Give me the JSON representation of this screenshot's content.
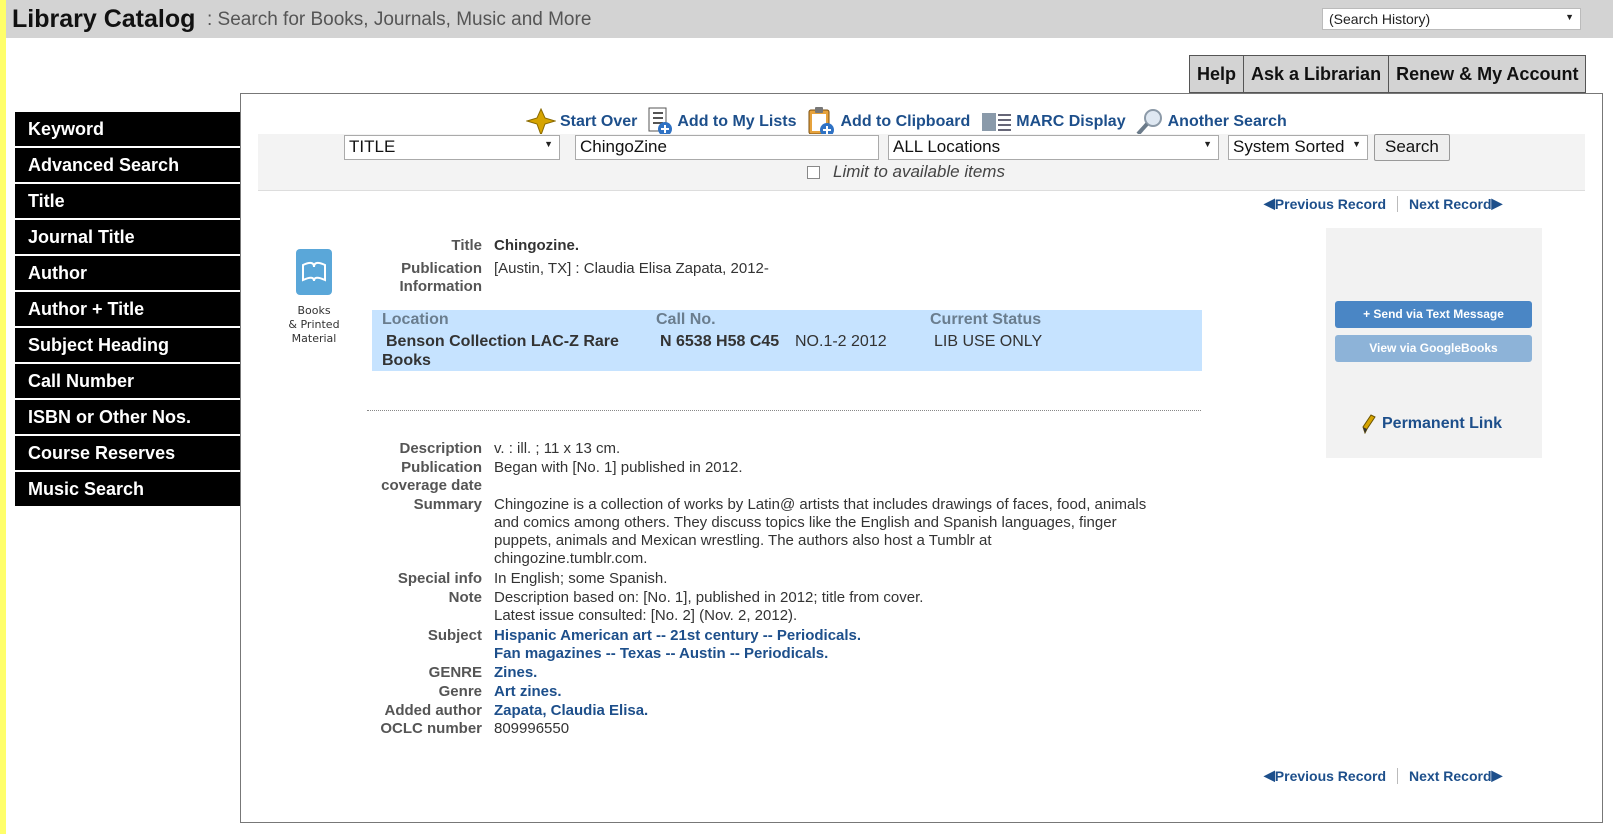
{
  "header": {
    "brand": "Library Catalog",
    "tagline": ": Search for Books, Journals, Music and More",
    "history_select": "(Search History)"
  },
  "topnav": [
    "Help",
    "Ask a Librarian",
    "Renew & My Account"
  ],
  "sidebar": [
    "Keyword",
    "Advanced Search",
    "Title",
    "Journal Title",
    "Author",
    "Author + Title",
    "Subject Heading",
    "Call Number",
    "ISBN or Other Nos.",
    "Course Reserves",
    "Music Search"
  ],
  "actions": {
    "start_over": "Start Over",
    "add_lists": "Add to My Lists",
    "add_clipboard": "Add to Clipboard",
    "marc": "MARC Display",
    "another": "Another Search"
  },
  "search": {
    "field": "TITLE",
    "query": "ChingoZine",
    "location": "ALL Locations",
    "sort": "System Sorted",
    "button": "Search",
    "limit_label": "Limit to available items"
  },
  "recnav": {
    "prev": "Previous Record",
    "next": "Next Record"
  },
  "format": {
    "line1": "Books",
    "line2": "& Printed",
    "line3": "Material"
  },
  "record": {
    "title_label": "Title",
    "title": "Chingozine.",
    "pub_label_1": "Publication",
    "pub_label_2": "Information",
    "publication": "[Austin, TX] : Claudia Elisa Zapata, 2012-",
    "desc_label": "Description",
    "description": "v. : ill. ; 11 x 13 cm.",
    "cov_label_1": "Publication",
    "cov_label_2": "coverage date",
    "coverage": "Began with [No. 1] published in 2012.",
    "summary_label": "Summary",
    "summary_1": "Chingozine is a collection of works by Latin@ artists that includes drawings of faces, food, animals",
    "summary_2": "and comics among others. They discuss topics like the English and Spanish languages, finger",
    "summary_3": "puppets, animals and Mexican wrestling. The authors also host a Tumblr at",
    "summary_4": "chingozine.tumblr.com.",
    "special_label": "Special info",
    "special": "In English; some Spanish.",
    "note_label": "Note",
    "note_1": "Description based on: [No. 1], published in 2012; title from cover.",
    "note_2": "Latest issue consulted: [No. 2] (Nov. 2, 2012).",
    "subject_label": "Subject",
    "subject_1": "Hispanic American art -- 21st century -- Periodicals.",
    "subject_2": "Fan magazines -- Texas -- Austin -- Periodicals.",
    "genre_upper_label": "GENRE",
    "genre_upper": "Zines.",
    "genre_label": "Genre",
    "genre": "Art zines.",
    "added_label": "Added author",
    "added": "Zapata, Claudia Elisa.",
    "oclc_label": "OCLC number",
    "oclc": "809996550"
  },
  "holdings": {
    "h_location": "Location",
    "h_call": "Call No.",
    "h_status": "Current Status",
    "location_1": "Benson Collection LAC-Z Rare",
    "location_2": "Books",
    "call": "N 6538 H58 C45",
    "volume": "NO.1-2 2012",
    "status": "LIB USE ONLY"
  },
  "rightbox": {
    "send_text": "+ Send via Text Message",
    "google": "View via GoogleBooks",
    "permalink": "Permanent Link"
  },
  "colors": {
    "link": "#1d4f8b",
    "button_blue": "#4a86c5",
    "button_blue_light": "#8db3d8",
    "highlight": "#c6e3ff"
  }
}
